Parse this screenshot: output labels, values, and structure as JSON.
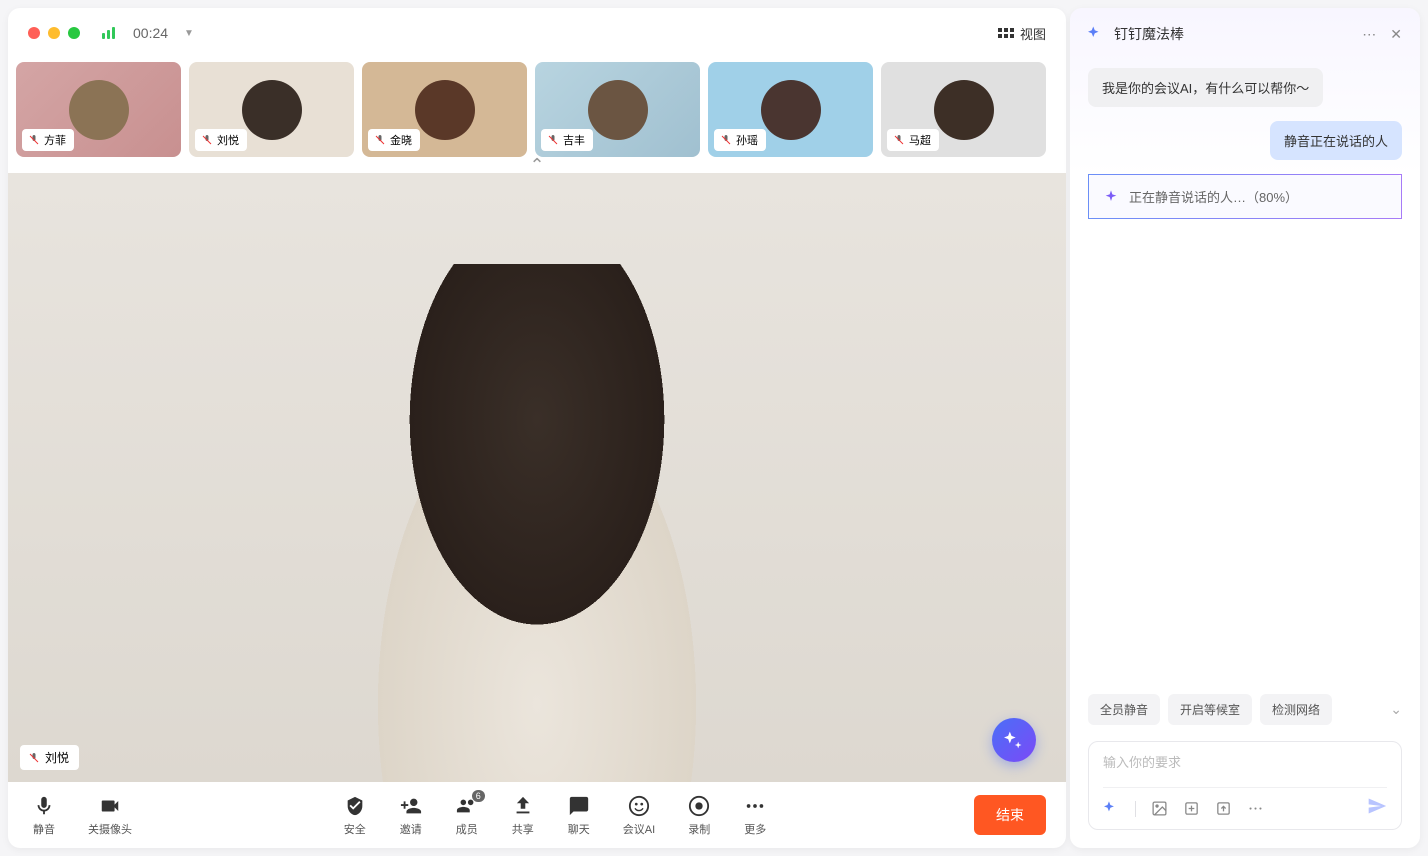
{
  "header": {
    "timer": "00:24",
    "view_label": "视图"
  },
  "participants": [
    {
      "name": "方菲"
    },
    {
      "name": "刘悦"
    },
    {
      "name": "金晓"
    },
    {
      "name": "吉丰"
    },
    {
      "name": "孙瑶"
    },
    {
      "name": "马超"
    }
  ],
  "main_speaker": {
    "name": "刘悦"
  },
  "controls": {
    "mute": "静音",
    "camera": "关摄像头",
    "security": "安全",
    "invite": "邀请",
    "members": "成员",
    "members_count": "6",
    "share": "共享",
    "chat": "聊天",
    "ai": "会议AI",
    "record": "录制",
    "more": "更多",
    "end": "结束"
  },
  "panel": {
    "title": "钉钉魔法棒",
    "ai_message": "我是你的会议AI，有什么可以帮你～",
    "user_message": "静音正在说话的人",
    "progress_text": "正在静音说话的人…（80%）",
    "quick_actions": [
      "全员静音",
      "开启等候室",
      "检测网络"
    ],
    "input_placeholder": "输入你的要求"
  }
}
